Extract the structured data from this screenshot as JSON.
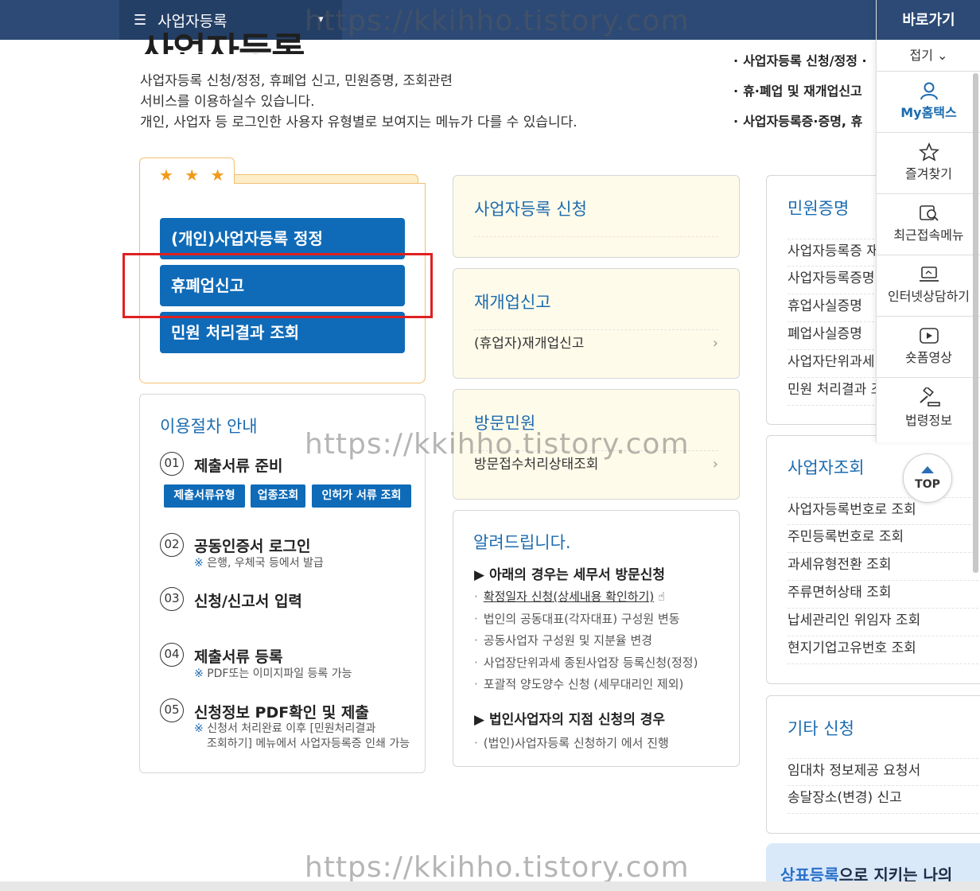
{
  "topbar": {
    "menu_icon": "☰",
    "menu_label": "사업자등록",
    "dropdown_icon": "▾"
  },
  "page": {
    "title": "사업자등록",
    "intro": [
      "사업자등록 신청/정정, 휴폐업 신고, 민원증명, 조회관련",
      "서비스를 이용하실수 있습니다.",
      "개인, 사업자 등 로그인한 사용자 유형별로 보여지는 메뉴가 다를 수 있습니다."
    ],
    "quick_links": [
      "사업자등록 신청/정정 ·",
      "휴·폐업 및 재개업신고",
      "사업자등록증·증명, 휴"
    ]
  },
  "favorites": {
    "stars": "★ ★ ★",
    "buttons": [
      "(개인)사업자등록 정정",
      "휴폐업신고",
      "민원 처리결과 조회"
    ]
  },
  "procedure": {
    "title": "이용절차 안내",
    "steps": [
      {
        "num": "01",
        "label": "제출서류 준비"
      },
      {
        "num": "02",
        "label": "공동인증서 로그인",
        "note": "은행, 우체국 등에서 발급"
      },
      {
        "num": "03",
        "label": "신청/신고서 입력"
      },
      {
        "num": "04",
        "label": "제출서류 등록",
        "note": "PDF또는 이미지파일 등록 가능"
      },
      {
        "num": "05",
        "label": "신청정보 PDF확인 및 제출",
        "note": "신청서 처리완료 이후 [민원처리결과",
        "note2": "조회하기] 메뉴에서 사업자등록증 인쇄 가능"
      }
    ],
    "note_mark": "※",
    "pills": [
      "제출서류유형",
      "업종조회",
      "인허가 서류 조회"
    ]
  },
  "center": {
    "register": {
      "title": "사업자등록 신청"
    },
    "reopen": {
      "title": "재개업신고",
      "items": [
        "(휴업자)재개업신고"
      ]
    },
    "visit": {
      "title": "방문민원",
      "items": [
        "방문접수처리상태조회"
      ]
    },
    "chevron": "›",
    "notice": {
      "title": "알려드립니다.",
      "head1": "▶ 아래의 경우는 세무서 방문신청",
      "items1": [
        "확정일자 신청(상세내용 확인하기)",
        "법인의 공동대표(각자대표) 구성원 변동",
        "공동사업자 구성원 및 지분율 변경",
        "사업장단위과세 종된사업장 등록신청(정정)",
        "포괄적 양도양수 신청 (세무대리인 제외)"
      ],
      "hand_icon": "☝",
      "head2": "▶ 법인사업자의 지점 신청의 경우",
      "items2": [
        "(법인)사업자등록 신청하기 에서 진행"
      ]
    }
  },
  "right": {
    "cert": {
      "title": "민원증명",
      "items": [
        "사업자등록증 재",
        "사업자등록증명",
        "휴업사실증명",
        "폐업사실증명",
        "사업자단위과세",
        "민원 처리결과 조"
      ]
    },
    "lookup": {
      "title": "사업자조회",
      "items": [
        "사업자등록번호로 조회",
        "주민등록번호로 조회",
        "과세유형전환 조회",
        "주류면허상태 조회",
        "납세관리인 위임자 조회",
        "현지기업고유번호 조회"
      ]
    },
    "etc": {
      "title": "기타 신청",
      "items": [
        "임대차 정보제공 요청서",
        "송달장소(변경) 신고"
      ]
    },
    "banner_highlight": "상표등록",
    "banner_rest": "으로 지키는 나의"
  },
  "quick_sidebar": {
    "title": "바로가기",
    "fold": "접기 ⌄",
    "items": [
      "My홈택스",
      "즐겨찾기",
      "최근접속메뉴",
      "인터넷상담하기",
      "숏폼영상",
      "법령정보"
    ]
  },
  "top_button": "TOP",
  "watermark": "https://kkihho.tistory.com",
  "colors": {
    "navy": "#2c4a75",
    "accent_blue": "#0f6bb8",
    "highlight_red": "#e02020",
    "card_cream": "#fffbea"
  }
}
